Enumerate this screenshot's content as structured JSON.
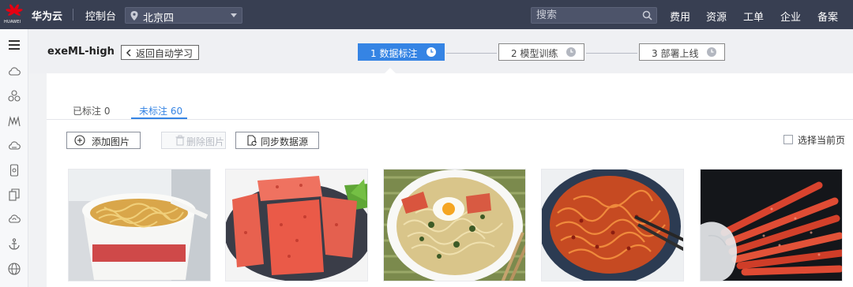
{
  "header": {
    "logo_text": "HUAWEI",
    "brand": "华为云",
    "console": "控制台",
    "region": "北京四",
    "search_placeholder": "搜索",
    "nav": [
      "费用",
      "资源",
      "工单",
      "企业",
      "备案"
    ]
  },
  "rail_icons": [
    "menu-icon",
    "cloud-icon",
    "cluster-icon",
    "network-icon",
    "cloud-storage-icon",
    "device-icon",
    "copy-icon",
    "cloud-outline-icon",
    "anchor-icon",
    "globe-icon"
  ],
  "workspace": {
    "title": "exeML-high",
    "back_label": "返回自动学习",
    "steps": [
      {
        "label": "1 数据标注",
        "active": true
      },
      {
        "label": "2 模型训练",
        "active": false
      },
      {
        "label": "3 部署上线",
        "active": false
      }
    ]
  },
  "tabs": [
    {
      "label": "已标注 0",
      "active": false
    },
    {
      "label": "未标注 60",
      "active": true
    }
  ],
  "toolbar": {
    "add_label": "添加图片",
    "delete_label": "删除图片",
    "sync_label": "同步数据源",
    "select_page_label": "选择当前页"
  },
  "images": [
    {
      "name": "cup-noodles-image"
    },
    {
      "name": "spicy-strips-image"
    },
    {
      "name": "noodle-bowl-egg-image"
    },
    {
      "name": "spicy-noodles-image"
    },
    {
      "name": "latiao-hand-image"
    }
  ],
  "colors": {
    "topbar": "#383f52",
    "accent": "#3584e4"
  }
}
